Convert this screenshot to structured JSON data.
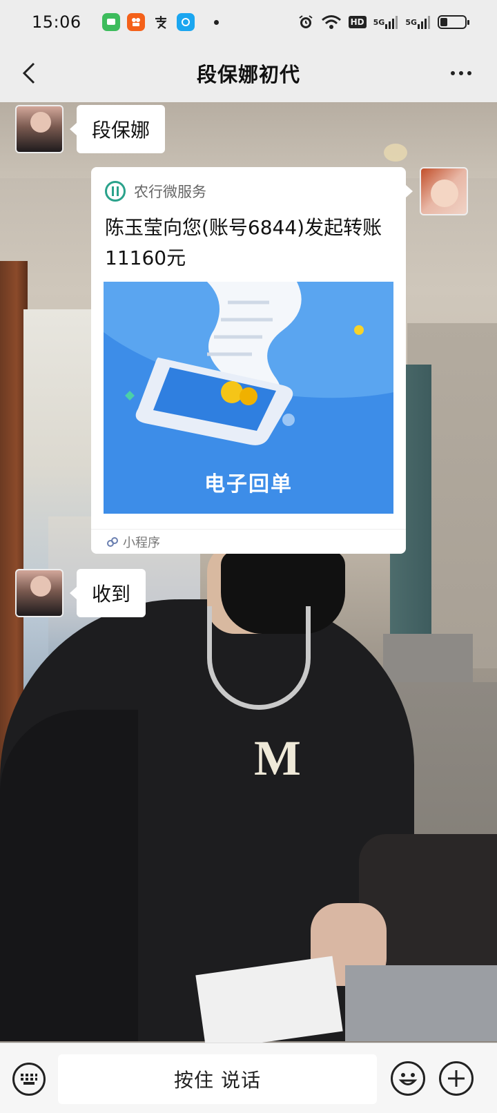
{
  "status_bar": {
    "time": "15:06",
    "apps": [
      {
        "icon": "wechat-icon",
        "color": "#3dbc5c",
        "glyph": "●"
      },
      {
        "icon": "kuaishou-icon",
        "color": "#f4611a",
        "glyph": "✿"
      },
      {
        "icon": "alipay-icon",
        "color": "#ffffff",
        "glyph": "支"
      },
      {
        "icon": "edge-icon",
        "color": "#1ba6f0",
        "glyph": "e"
      }
    ],
    "hd": "HD",
    "signal1": "5G",
    "signal2": "5G",
    "battery_level": 0.3
  },
  "nav": {
    "title": "段保娜初代"
  },
  "messages": {
    "first": {
      "text": "段保娜"
    },
    "card": {
      "source": "农行微服务",
      "title": "陈玉莹向您(账号6844)发起转账11160元",
      "image_caption": "电子回单",
      "footer_label": "小程序"
    },
    "third": {
      "text": "收到"
    }
  },
  "input_bar": {
    "voice_label": "按住 说话"
  },
  "colors": {
    "accent_green": "#2aa28b",
    "card_blue": "#3d8de8"
  }
}
